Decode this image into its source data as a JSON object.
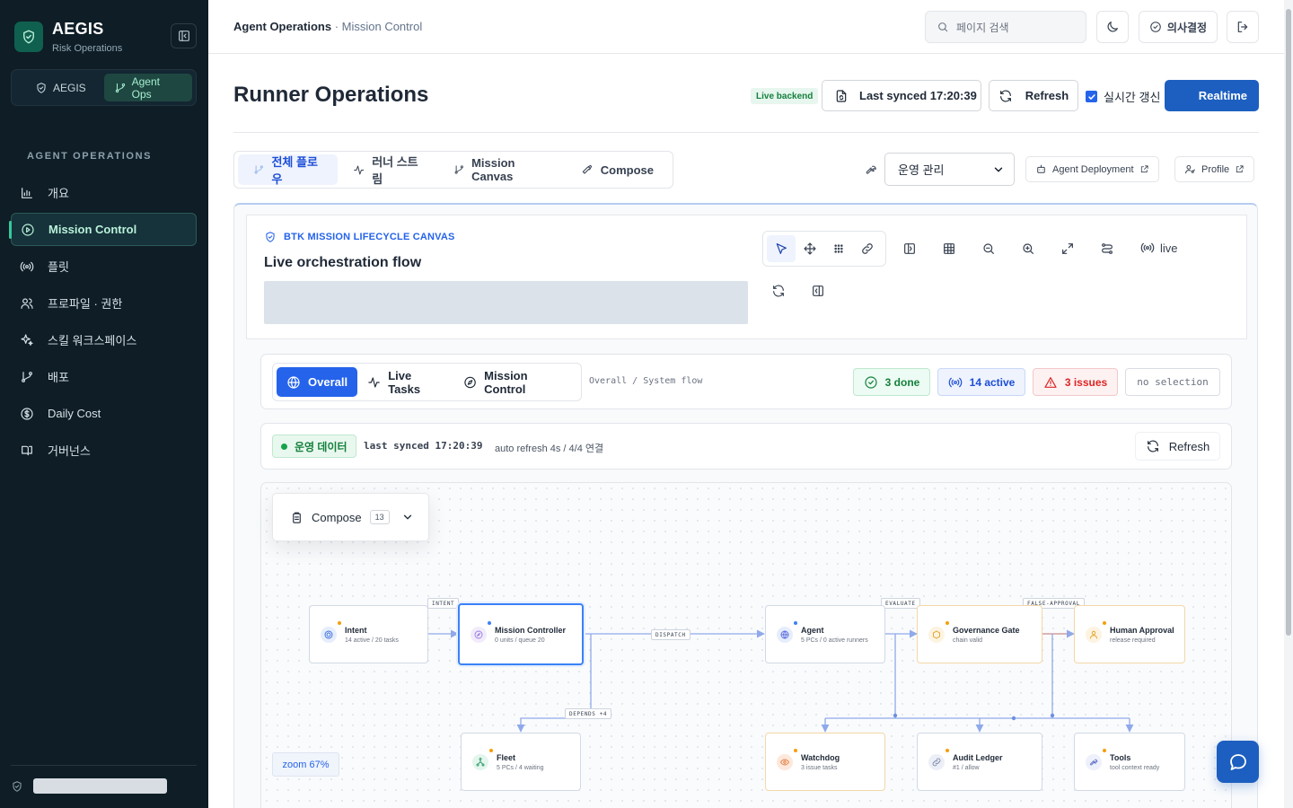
{
  "brand": {
    "name": "AEGIS",
    "subtitle": "Risk Operations"
  },
  "switcher": {
    "left": "AEGIS",
    "right": "Agent Ops"
  },
  "sidebar": {
    "section": "AGENT OPERATIONS",
    "items": [
      {
        "label": "개요",
        "icon": "bar-chart-icon"
      },
      {
        "label": "Mission Control",
        "icon": "play-circle-icon",
        "active": true
      },
      {
        "label": "플릿",
        "icon": "radio-broadcast-icon"
      },
      {
        "label": "프로파일 · 권한",
        "icon": "users-icon"
      },
      {
        "label": "스킬 워크스페이스",
        "icon": "sparkles-icon"
      },
      {
        "label": "배포",
        "icon": "git-branch-icon"
      },
      {
        "label": "Daily Cost",
        "icon": "dollar-circle-icon"
      },
      {
        "label": "거버넌스",
        "icon": "book-icon"
      }
    ]
  },
  "header": {
    "breadcrumb_parent": "Agent Operations",
    "breadcrumb_sep": " · ",
    "breadcrumb_current": "Mission Control",
    "search_placeholder": "페이지 검색",
    "decision_label": "의사결정"
  },
  "page": {
    "title": "Runner Operations",
    "live_backend": "Live backend",
    "last_synced": "Last synced 17:20:39",
    "refresh_label": "Refresh",
    "realtime_check_label": "실시간 갱신",
    "realtime_button": "Realtime"
  },
  "tabs": [
    {
      "label": "전체 플로우",
      "active": true
    },
    {
      "label": "러너 스트림"
    },
    {
      "label": "Mission Canvas"
    },
    {
      "label": "Compose"
    }
  ],
  "ops_select": {
    "value": "운영 관리"
  },
  "links": {
    "deployment": "Agent Deployment",
    "profile": "Profile"
  },
  "canvas": {
    "eyebrow": "BTK MISSION LIFECYCLE CANVAS",
    "title": "Live orchestration flow",
    "live_label": "live"
  },
  "views": {
    "tabs": [
      {
        "label": "Overall",
        "active": true
      },
      {
        "label": "Live Tasks"
      },
      {
        "label": "Mission Control"
      }
    ],
    "path": "Overall / System flow",
    "done": "3 done",
    "active": "14 active",
    "issues": "3 issues",
    "selection": "no selection"
  },
  "status": {
    "badge": "운영 데이터",
    "synced": "last synced 17:20:39",
    "auto_refresh": "auto refresh 4s / 4/4 연결",
    "refresh_label": "Refresh"
  },
  "compose": {
    "label": "Compose",
    "count": "13"
  },
  "zoom": "zoom 67%",
  "nodes": [
    {
      "title": "Intent",
      "sub": "14 active / 20 tasks",
      "icon": "target-icon"
    },
    {
      "title": "Mission Controller",
      "sub": "0 units / queue 20",
      "icon": "compass-icon"
    },
    {
      "title": "Agent",
      "sub": "5 PCs / 0 active runners",
      "icon": "globe-icon"
    },
    {
      "title": "Governance Gate",
      "sub": "chain valid",
      "icon": "hexagon-icon"
    },
    {
      "title": "Human Approval",
      "sub": "release required",
      "icon": "person-icon"
    },
    {
      "title": "Fleet",
      "sub": "5 PCs / 4 waiting",
      "icon": "network-icon"
    },
    {
      "title": "Watchdog",
      "sub": "3 issue tasks",
      "icon": "eye-icon"
    },
    {
      "title": "Audit Ledger",
      "sub": "#1 / allow",
      "icon": "link-icon"
    },
    {
      "title": "Tools",
      "sub": "tool context ready",
      "icon": "wrench-icon"
    }
  ],
  "edges": {
    "intent": "INTENT",
    "dispatch": "DISPATCH",
    "evaluate": "EVALUATE",
    "false_approval": "FALSE-APPROVAL",
    "depends": "DEPENDS +4"
  },
  "colors": {
    "sidebar_bg": "#0e1d26",
    "accent": "#1d5fc0",
    "success": "#15803d",
    "danger": "#dc2626",
    "edge": "#8fa9ea"
  }
}
